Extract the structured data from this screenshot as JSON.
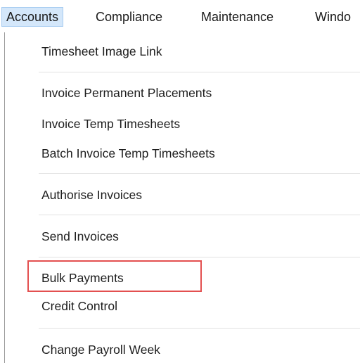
{
  "menubar": {
    "items": [
      {
        "label": "Accounts",
        "active": true
      },
      {
        "label": "Compliance",
        "active": false
      },
      {
        "label": "Maintenance",
        "active": false
      },
      {
        "label": "Windo",
        "active": false
      }
    ]
  },
  "dropdown": {
    "items": [
      {
        "label": "Timesheet Image Link"
      },
      {
        "label": "Invoice Permanent Placements"
      },
      {
        "label": "Invoice Temp Timesheets"
      },
      {
        "label": "Batch Invoice Temp Timesheets"
      },
      {
        "label": "Authorise Invoices"
      },
      {
        "label": "Send Invoices"
      },
      {
        "label": "Bulk Payments",
        "highlighted": true
      },
      {
        "label": "Credit Control"
      },
      {
        "label": "Change Payroll Week"
      }
    ]
  },
  "colors": {
    "active_menu_bg": "#d4e7fa",
    "active_menu_border": "#a6cbf0",
    "highlight_outline": "#e35050",
    "separator": "#e2e2e2"
  }
}
